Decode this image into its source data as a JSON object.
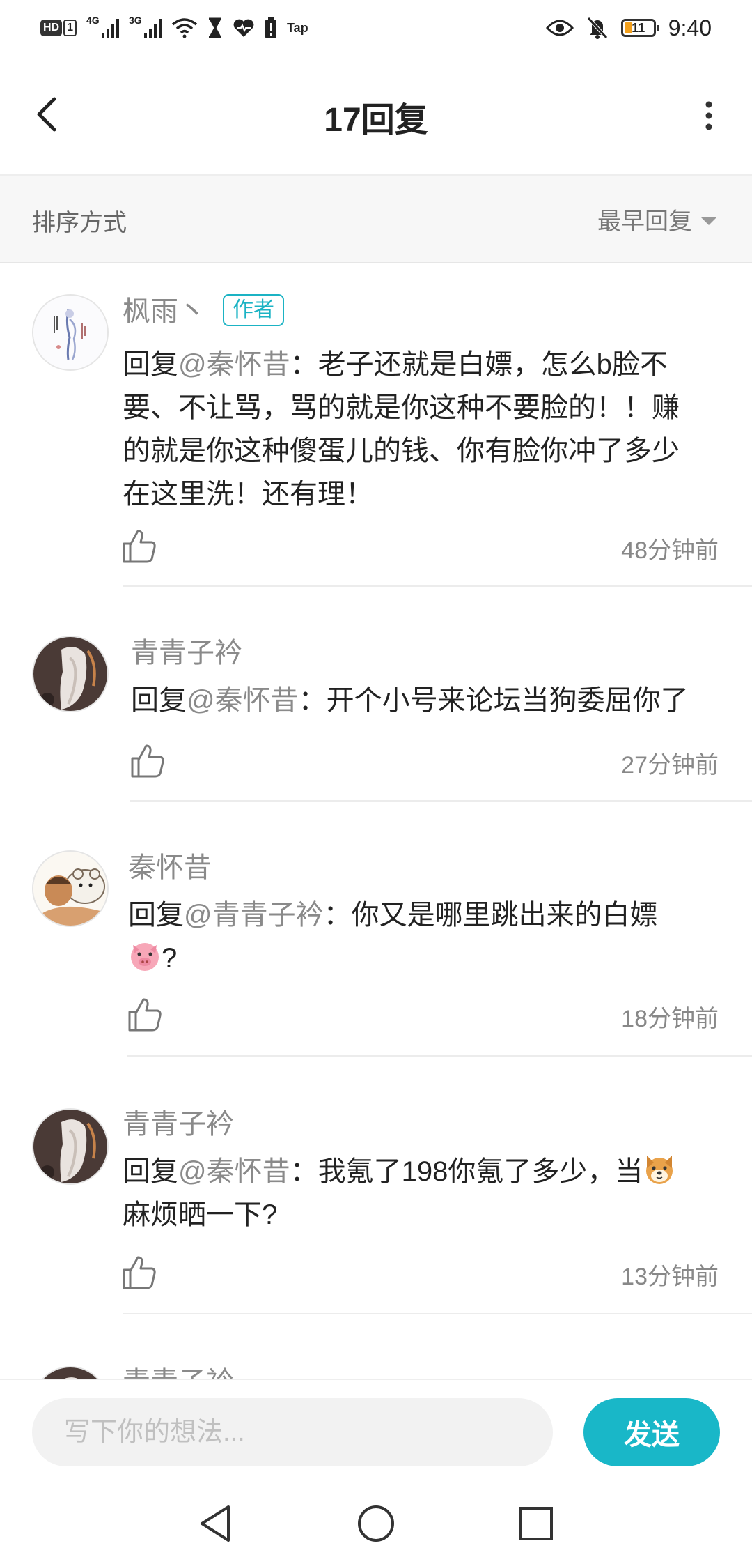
{
  "status_bar": {
    "left_badges": [
      "HD",
      "1"
    ],
    "signal_1": "4G",
    "signal_2": "3G",
    "app_label": "Tap",
    "battery": "11",
    "time": "9:40"
  },
  "header": {
    "title": "17回复"
  },
  "sort_bar": {
    "label": "排序方式",
    "selected": "最早回复"
  },
  "comments": [
    {
      "username": "枫雨丶",
      "tag": "作者",
      "reply_prefix": "回复",
      "mention": "@秦怀昔",
      "colon": "：",
      "lines": [
        "老子还就是白嫖，怎么b脸不",
        "要、不让骂，骂的就是你这种不要脸的！！赚",
        "的就是你这种傻蛋儿的钱、你有脸你冲了多少",
        "在这里洗！还有理！"
      ],
      "time": "48分钟前"
    },
    {
      "username": "青青子衿",
      "reply_prefix": "回复",
      "mention": "@秦怀昔",
      "colon": "：",
      "lines": [
        "开个小号来论坛当狗委屈你了"
      ],
      "time": "27分钟前"
    },
    {
      "username": "秦怀昔",
      "reply_prefix": "回复",
      "mention": "@青青子衿",
      "colon": "：",
      "lines": [
        "你又是哪里跳出来的白嫖",
        "?"
      ],
      "emoji": "pig-face-emoji",
      "time": "18分钟前"
    },
    {
      "username": "青青子衿",
      "reply_prefix": "回复",
      "mention": "@秦怀昔",
      "colon": "：",
      "lines": [
        "我氪了198你氪了多少，当",
        "麻烦晒一下?"
      ],
      "emoji": "dog-face-emoji",
      "time": "13分钟前"
    },
    {
      "username": "青青子衿"
    }
  ],
  "input_bar": {
    "placeholder": "写下你的想法...",
    "send_label": "发送"
  },
  "colors": {
    "accent": "#19b7c8",
    "mention": "#8a8a8a"
  }
}
